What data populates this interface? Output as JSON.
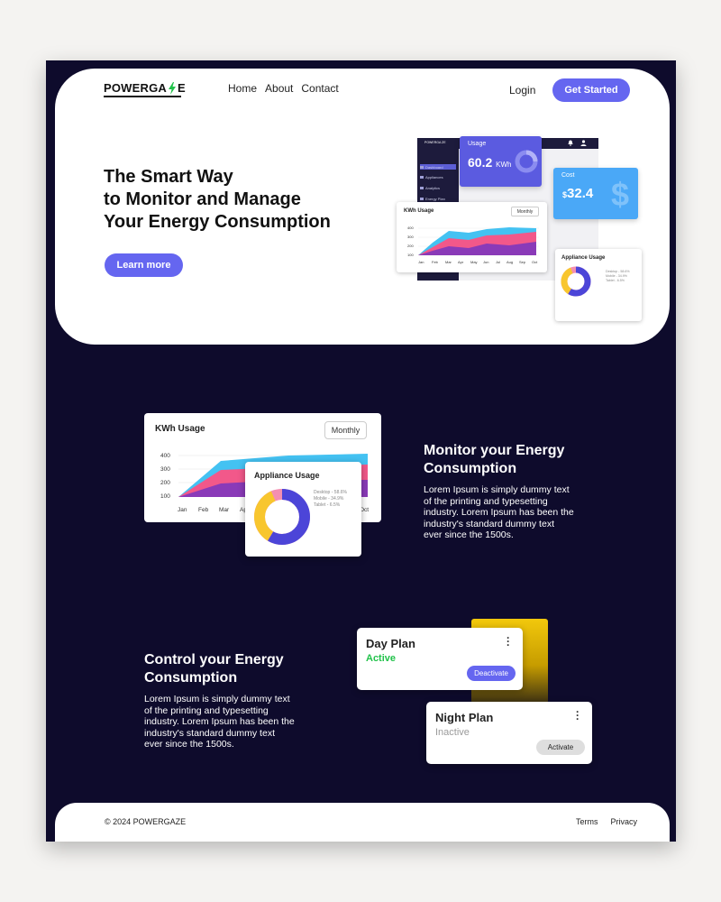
{
  "brand": {
    "name_left": "POWERGA",
    "name_right": "E",
    "bolt_color": "#21c24a"
  },
  "nav": {
    "items": [
      "Home",
      "About",
      "Contact"
    ],
    "login": "Login",
    "cta": "Get Started"
  },
  "hero": {
    "title_lines": [
      "The Smart Way",
      "to Monitor and Manage",
      "Your Energy Consumption"
    ],
    "button": "Learn more"
  },
  "dashboard": {
    "sidebar_brand": "POWERGA ZE",
    "sidebar_items": [
      "Dashboard",
      "Appliances",
      "Analytics",
      "Energy Plan"
    ],
    "usage_label": "Usage",
    "usage_value": "60.2",
    "usage_unit": "KWh",
    "cost_label": "Cost",
    "cost_currency": "$",
    "cost_value": "32.4"
  },
  "kwh_chart_small": {
    "title": "KWh Usage",
    "period": "Monthly",
    "y_ticks": [
      "400",
      "300",
      "200",
      "100"
    ],
    "x_labels": [
      "Jan",
      "Feb",
      "Mar",
      "Apr",
      "May",
      "Jun",
      "Jul",
      "Aug",
      "Sep",
      "Oct"
    ]
  },
  "appliance_small": {
    "title": "Appliance Usage",
    "legend": [
      "Desktop - 58.6%",
      "Mobile - 34.9%",
      "Tablet - 6.5%"
    ]
  },
  "feature_monitor": {
    "chart_title": "KWh  Usage",
    "period": "Monthly",
    "y_ticks": [
      "400",
      "300",
      "200",
      "100"
    ],
    "x_labels": [
      "Jan",
      "Feb",
      "Mar",
      "Ap",
      "Oct"
    ],
    "appliance_title": "Appliance Usage",
    "appliance_legend": [
      "Desktop - 58.6%",
      "Mobile - 34.9%",
      "Tablet - 6.5%"
    ],
    "title_lines": [
      "Monitor your Energy",
      "Consumption"
    ],
    "text_lines": [
      "Lorem Ipsum is simply dummy text",
      "of the printing and typesetting",
      "industry. Lorem Ipsum has been the",
      "industry's standard dummy text",
      "ever since the 1500s."
    ]
  },
  "feature_control": {
    "title_lines": [
      "Control your Energy",
      "Consumption"
    ],
    "text_lines": [
      "Lorem Ipsum is simply dummy text",
      "of the printing and typesetting",
      "industry. Lorem Ipsum has been the",
      "industry's standard dummy text",
      "ever since the 1500s."
    ],
    "day_plan": {
      "name": "Day Plan",
      "status": "Active",
      "button": "Deactivate"
    },
    "night_plan": {
      "name": "Night Plan",
      "status": "Inactive",
      "button": "Activate"
    }
  },
  "footer": {
    "copyright": "© 2024 POWERGAZE",
    "links": [
      "Terms",
      "Privacy"
    ]
  },
  "colors": {
    "accent": "#6566f0",
    "dark_bg": "#0e0b2c",
    "active_green": "#21c24a",
    "cost_blue": "#4aa8f7",
    "area_cyan": "#44c2f2",
    "area_pink": "#f2588a",
    "area_purple": "#8a3ab8",
    "donut_purple": "#4c45d8",
    "donut_yellow": "#f8c62e",
    "donut_pink": "#f48fb1"
  },
  "icons": [
    "bolt-icon",
    "dollar-icon",
    "bell-icon",
    "user-icon",
    "kebab-menu-icon",
    "donut-gauge-icon"
  ]
}
